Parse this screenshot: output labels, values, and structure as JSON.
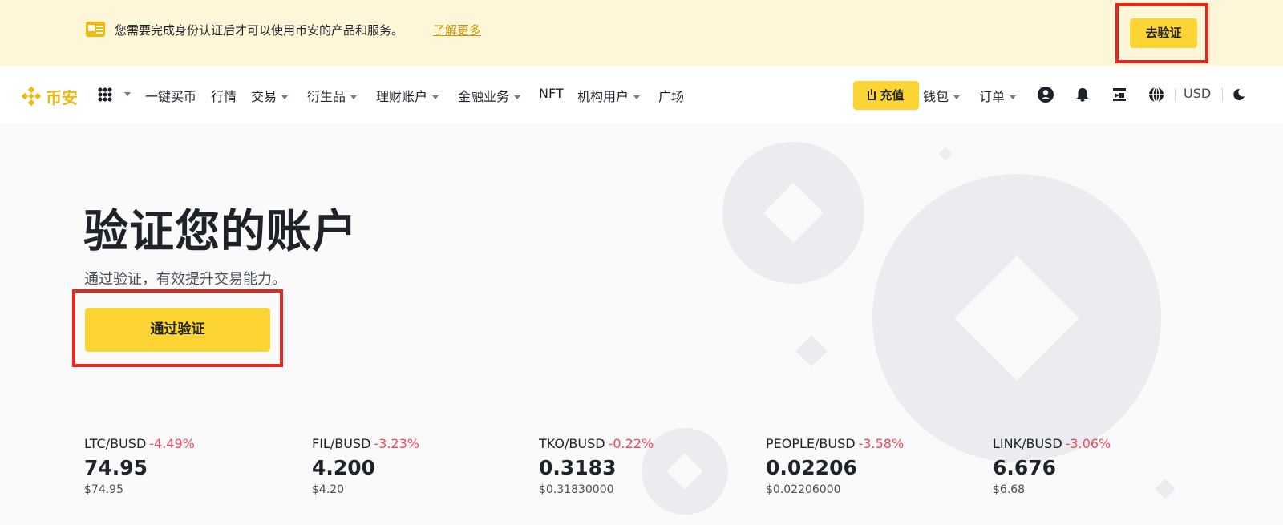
{
  "banner": {
    "message": "您需要完成身份认证后才可以使用币安的产品和服务。",
    "link": "了解更多",
    "button": "去验证"
  },
  "nav": {
    "logo_text": "币安",
    "items": [
      "一键买币",
      "行情",
      "交易",
      "衍生品",
      "理财账户",
      "金融业务",
      "NFT",
      "机构用户",
      "广场"
    ],
    "deposit": "充值",
    "wallet": "钱包",
    "orders": "订单",
    "currency": "USD"
  },
  "hero": {
    "title": "验证您的账户",
    "subtitle": "通过验证，有效提升交易能力。",
    "cta": "通过验证"
  },
  "tickers": [
    {
      "pair": "LTC/BUSD",
      "change": "-4.49%",
      "price": "74.95",
      "usd": "$74.95"
    },
    {
      "pair": "FIL/BUSD",
      "change": "-3.23%",
      "price": "4.200",
      "usd": "$4.20"
    },
    {
      "pair": "TKO/BUSD",
      "change": "-0.22%",
      "price": "0.3183",
      "usd": "$0.31830000"
    },
    {
      "pair": "PEOPLE/BUSD",
      "change": "-3.58%",
      "price": "0.02206",
      "usd": "$0.02206000"
    },
    {
      "pair": "LINK/BUSD",
      "change": "-3.06%",
      "price": "6.676",
      "usd": "$6.68"
    }
  ],
  "colors": {
    "brand": "#f0b90b",
    "button": "#fcd535",
    "negative": "#f6465d",
    "highlight": "#e8261d"
  }
}
